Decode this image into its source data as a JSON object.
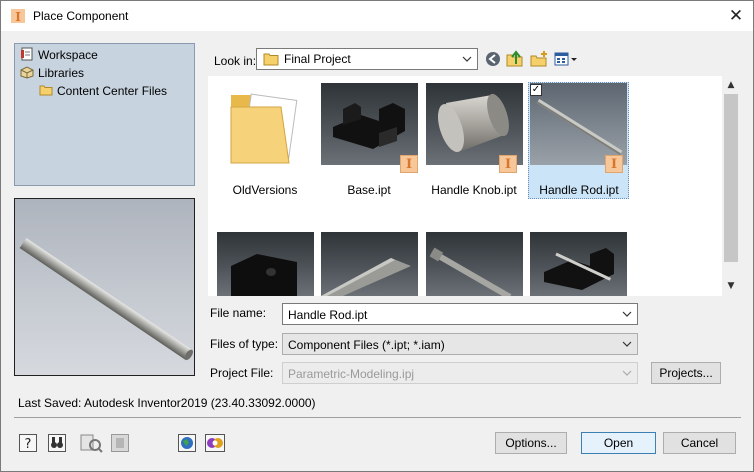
{
  "window": {
    "title": "Place Component",
    "close_glyph": "✕"
  },
  "nav": {
    "items": [
      {
        "label": "Workspace",
        "icon": "workspace-icon"
      },
      {
        "label": "Libraries",
        "icon": "libraries-icon"
      },
      {
        "label": "Content Center Files",
        "icon": "folder-icon"
      }
    ]
  },
  "look_in": {
    "label": "Look in:",
    "value": "Final Project"
  },
  "toolbar": {
    "icons": [
      "back-icon",
      "up-folder-icon",
      "new-folder-icon",
      "views-menu-icon"
    ]
  },
  "files": {
    "items": [
      {
        "name": "OldVersions",
        "type": "folder"
      },
      {
        "name": "Base.ipt",
        "type": "part"
      },
      {
        "name": "Handle Knob.ipt",
        "type": "part"
      },
      {
        "name": "Handle Rod.ipt",
        "type": "part",
        "selected": true
      }
    ],
    "second_row_thumbnail_count": 4,
    "badge_letter": "I",
    "checkmark": "✓"
  },
  "fields": {
    "file_name": {
      "label": "File name:",
      "value": "Handle Rod.ipt"
    },
    "files_of_type": {
      "label": "Files of type:",
      "value": "Component Files (*.ipt; *.iam)"
    },
    "project_file": {
      "label": "Project File:",
      "value": "Parametric-Modeling.ipj"
    }
  },
  "buttons": {
    "projects": "Projects...",
    "options": "Options...",
    "open": "Open",
    "cancel": "Cancel"
  },
  "status": {
    "last_saved": "Last Saved: Autodesk Inventor2019 (23.40.33092.0000)"
  },
  "bottom_icons": [
    "help-icon",
    "find-binoculars-icon",
    "file-search-icon",
    "filter-icon",
    "globe-icon",
    "iproperties-icon"
  ],
  "colors": {
    "selection": "#cce4f7",
    "badge": "#f7c79a",
    "nav_panel": "#c7d3df"
  }
}
